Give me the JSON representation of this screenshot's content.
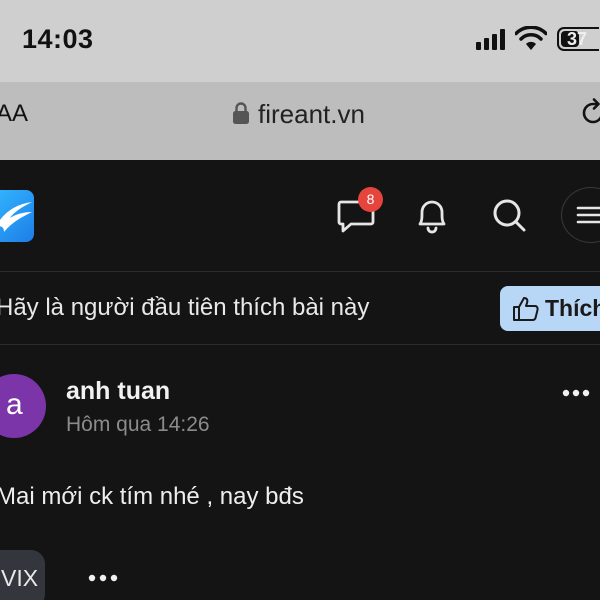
{
  "status_bar": {
    "time": "14:03",
    "battery": "37"
  },
  "browser": {
    "aa_label": "AA",
    "url": "fireant.vn"
  },
  "header": {
    "messages_badge": "8",
    "icons": [
      "fireant-logo-icon",
      "chat-icon",
      "bell-icon",
      "search-icon",
      "menu-icon"
    ]
  },
  "like_bar": {
    "text": "Hãy là người đầu tiên thích bài này",
    "like_label": "Thích"
  },
  "post": {
    "avatar_letter": "a",
    "avatar_color": "#7b35a8",
    "author": "anh tuan",
    "timestamp": "Hôm qua 14:26",
    "content": "Mai mới ck tím nhé , nay bđs",
    "tag": "VIX"
  },
  "colors": {
    "background": "#141414",
    "badge": "#e5453d",
    "like_button": "#b8d6f6"
  }
}
